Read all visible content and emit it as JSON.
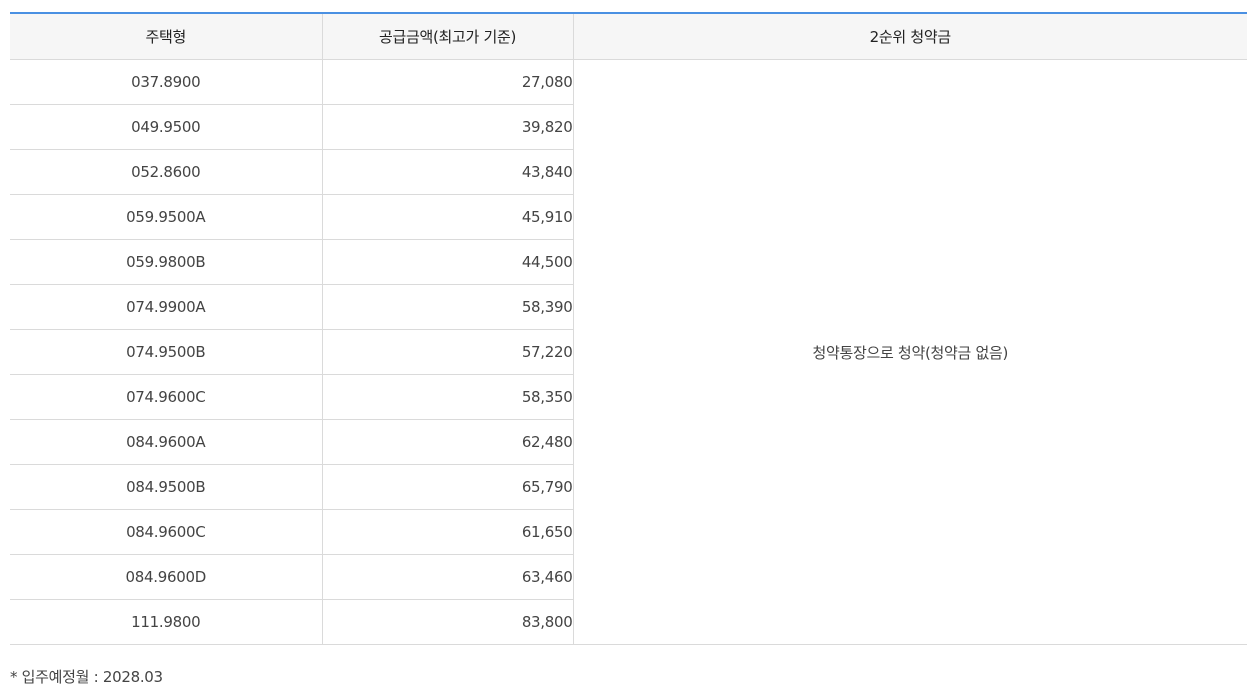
{
  "table": {
    "headers": [
      "주택형",
      "공급금액(최고가 기준)",
      "2순위 청약금"
    ],
    "rows": [
      {
        "type": "037.8900",
        "amount": "27,080"
      },
      {
        "type": "049.9500",
        "amount": "39,820"
      },
      {
        "type": "052.8600",
        "amount": "43,840"
      },
      {
        "type": "059.9500A",
        "amount": "45,910"
      },
      {
        "type": "059.9800B",
        "amount": "44,500"
      },
      {
        "type": "074.9900A",
        "amount": "58,390"
      },
      {
        "type": "074.9500B",
        "amount": "57,220"
      },
      {
        "type": "074.9600C",
        "amount": "58,350"
      },
      {
        "type": "084.9600A",
        "amount": "62,480"
      },
      {
        "type": "084.9500B",
        "amount": "65,790"
      },
      {
        "type": "084.9600C",
        "amount": "61,650"
      },
      {
        "type": "084.9600D",
        "amount": "63,460"
      },
      {
        "type": "111.9800",
        "amount": "83,800"
      }
    ],
    "deposit_text": "청약통장으로 청약(청약금 없음)"
  },
  "note": "* 입주예정월 : 2028.03",
  "colors": {
    "accent_top_border": "#4a90e2",
    "header_bg": "#f6f6f6",
    "grid_line": "#dadada"
  }
}
